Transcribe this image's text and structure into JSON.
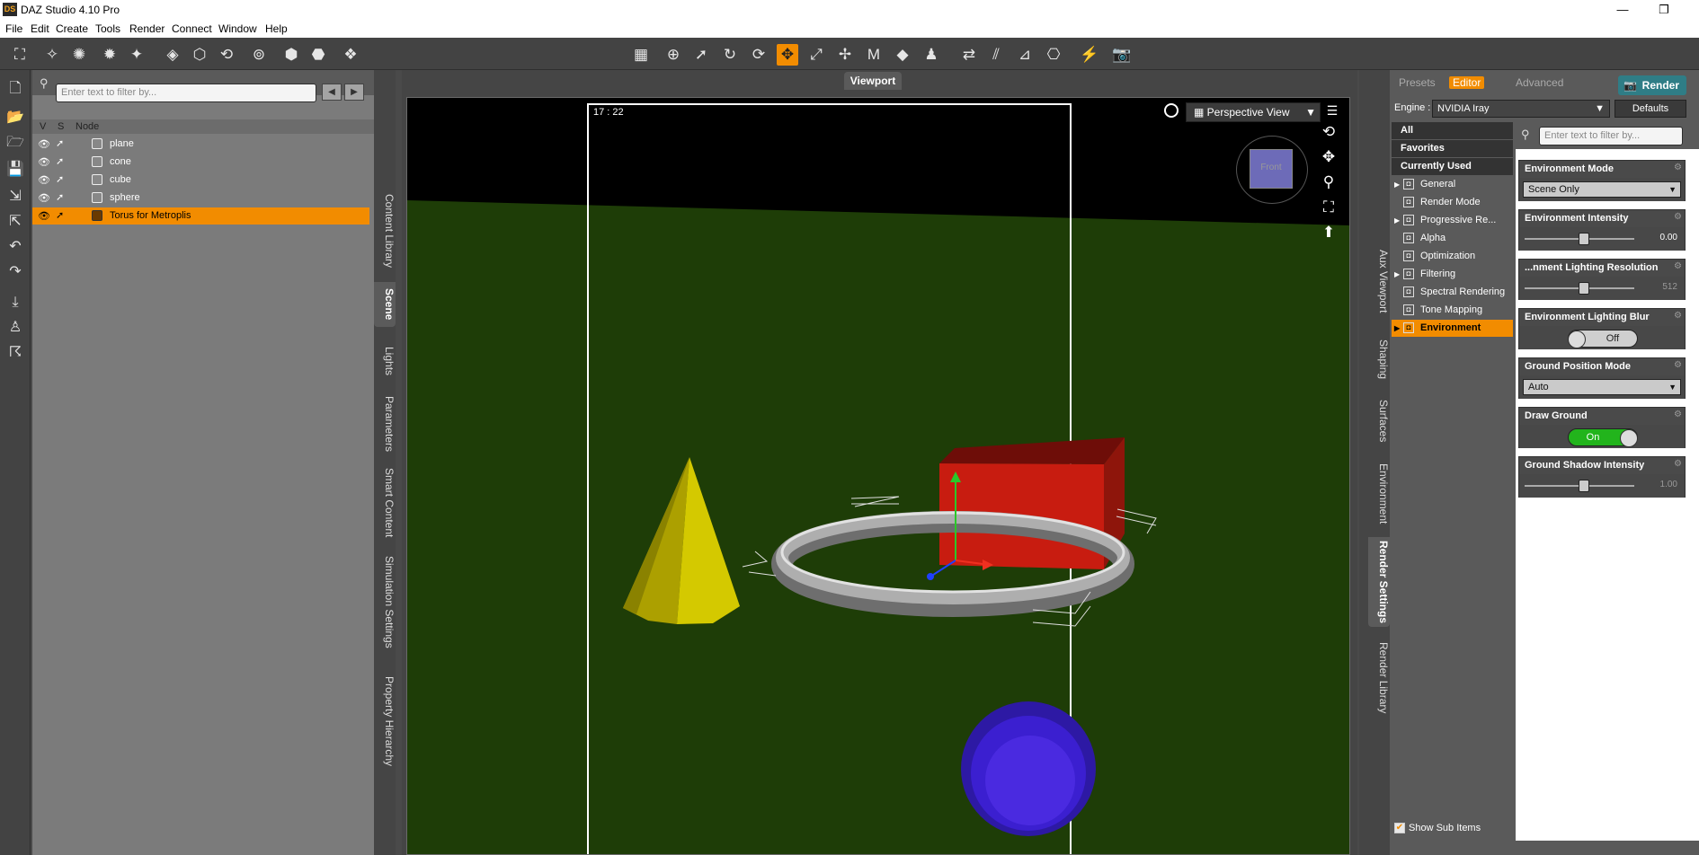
{
  "window": {
    "title": "DAZ Studio 4.10 Pro",
    "logo": "DS",
    "minimize": "—",
    "restore": "❐",
    "close": "✕"
  },
  "menu": [
    "File",
    "Edit",
    "Create",
    "Tools",
    "Render",
    "Connect",
    "Window",
    "Help"
  ],
  "scene": {
    "filter_placeholder": "Enter text to filter by...",
    "col_v": "V",
    "col_s": "S",
    "col_node": "Node",
    "nodes": [
      "plane",
      "cone",
      "cube",
      "sphere",
      "Torus for Metroplis"
    ]
  },
  "left_tabs": [
    "Content Library",
    "Scene",
    "Lights",
    "Parameters",
    "Smart Content",
    "Simulation Settings",
    "Property Hierarchy"
  ],
  "viewport": {
    "tab": "Viewport",
    "time": "17 : 22",
    "view": "Perspective View",
    "cube_label": "Front"
  },
  "right_tabs": [
    "Aux Viewport",
    "Shaping",
    "Surfaces",
    "Environment",
    "Render Settings",
    "Render Library"
  ],
  "render": {
    "tabs": [
      "Presets",
      "Editor",
      "Advanced"
    ],
    "render_button": "Render",
    "engine_label": "Engine :",
    "engine_value": "NVIDIA Iray",
    "defaults_button": "Defaults",
    "filter_placeholder": "Enter text to filter by...",
    "categories": [
      "All",
      "Favorites",
      "Currently Used"
    ],
    "groups": [
      "General",
      "Render Mode",
      "Progressive Re...",
      "Alpha",
      "Optimization",
      "Filtering",
      "Spectral Rendering",
      "Tone Mapping",
      "Environment"
    ],
    "show_sub_items": "Show Sub Items",
    "props": {
      "env_mode": {
        "label": "Environment Mode",
        "value": "Scene Only"
      },
      "env_intensity": {
        "label": "Environment Intensity",
        "value": "0.00"
      },
      "env_res": {
        "label": "...nment Lighting Resolution",
        "value": "512"
      },
      "env_blur": {
        "label": "Environment Lighting Blur",
        "value": "Off"
      },
      "ground_pos": {
        "label": "Ground Position Mode",
        "value": "Auto"
      },
      "draw_ground": {
        "label": "Draw Ground",
        "value": "On"
      },
      "ground_shadow": {
        "label": "Ground Shadow Intensity",
        "value": "1.00"
      }
    }
  },
  "colors": {
    "accent": "#f28c00",
    "ground": "#1e3d07",
    "cone": "#d4c900",
    "cube": "#c81c10",
    "sphere": "#3b1fd0",
    "toggle_on": "#22b41c"
  }
}
